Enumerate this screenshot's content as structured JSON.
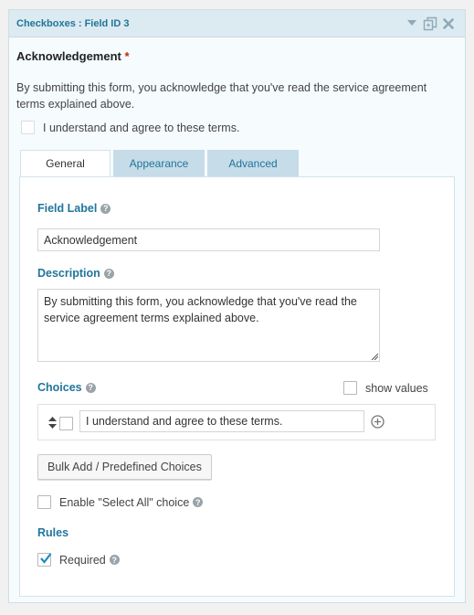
{
  "header": {
    "title": "Checkboxes : Field ID 3",
    "icons": [
      "collapse-arrow-icon",
      "duplicate-icon",
      "delete-icon"
    ]
  },
  "preview": {
    "label": "Acknowledgement",
    "required_marker": "*",
    "description": "By submitting this form, you acknowledge that you've read the service agreement terms explained above.",
    "choice_label": "I understand and agree to these terms."
  },
  "tabs": [
    {
      "label": "General",
      "active": true
    },
    {
      "label": "Appearance",
      "active": false
    },
    {
      "label": "Advanced",
      "active": false
    }
  ],
  "general": {
    "field_label_title": "Field Label",
    "field_label_value": "Acknowledgement",
    "description_title": "Description",
    "description_value": "By submitting this form, you acknowledge that you've read the service agreement terms explained above.",
    "choices_title": "Choices",
    "show_values_label": "show values",
    "show_values_checked": false,
    "choice_value": "I understand and agree to these terms.",
    "bulk_add_label": "Bulk Add / Predefined Choices",
    "select_all_label": "Enable \"Select All\" choice",
    "select_all_checked": false,
    "rules_title": "Rules",
    "required_label": "Required",
    "required_checked": true
  },
  "colors": {
    "accent": "#21759b",
    "required_star": "#c02b0a",
    "header_bg": "#dceaf1",
    "tab_inactive_bg": "#c6dce8"
  }
}
